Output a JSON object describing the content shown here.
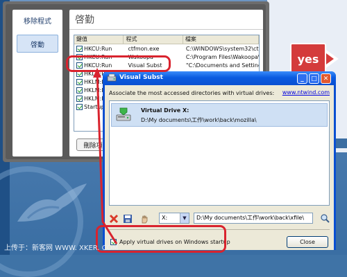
{
  "background": {
    "yes_label": "yes",
    "accent": "#d9232e"
  },
  "settings_panel": {
    "side_items": [
      "移除程式",
      "啓動"
    ],
    "title": "啓勤",
    "columns": [
      "鍵值",
      "程式",
      "檔案"
    ],
    "rows": [
      {
        "key": "HKCU:Run",
        "program": "ctfmon.exe",
        "file": "C:\\WINDOWS\\system32\\ctfmon"
      },
      {
        "key": "HKCU:Run",
        "program": "Wakoopa",
        "file": "C:\\Program Files\\Wakoopa\\Wak"
      },
      {
        "key": "HKCU:Run",
        "program": "Visual Subst",
        "file": "\"C:\\Documents and Settings\\ch"
      },
      {
        "key": "HKLM:R",
        "program": "",
        "file": ""
      },
      {
        "key": "HKLM:R",
        "program": "",
        "file": ""
      },
      {
        "key": "HKLM:R",
        "program": "",
        "file": ""
      },
      {
        "key": "HKLM:R",
        "program": "",
        "file": ""
      },
      {
        "key": "Startup",
        "program": "",
        "file": ""
      }
    ],
    "remove_button": "刪除項"
  },
  "dialog": {
    "title": "Visual Subst",
    "description": "Associate the most accessed directories with virtual drives:",
    "website": "www.ntwind.com",
    "drive_name": "Virtual Drive X:",
    "drive_path": "D:\\My documents\\工作\\work\\back\\mozilla\\",
    "drive_letter": "X:",
    "path_value": "D:\\My documents\\工作\\work\\back\\xfile\\",
    "startup_label": "Apply virtual drives on Windows startup",
    "close_button": "Close",
    "minimize": "_",
    "maximize": "□",
    "close_x": "✕"
  },
  "footer": {
    "text": "上传于：新客网 WWW. XKER. COM"
  },
  "icons": [
    "shield-icon",
    "drive-icon",
    "delete-icon",
    "save-icon",
    "hand-icon",
    "browse-icon",
    "arrow-icon"
  ]
}
